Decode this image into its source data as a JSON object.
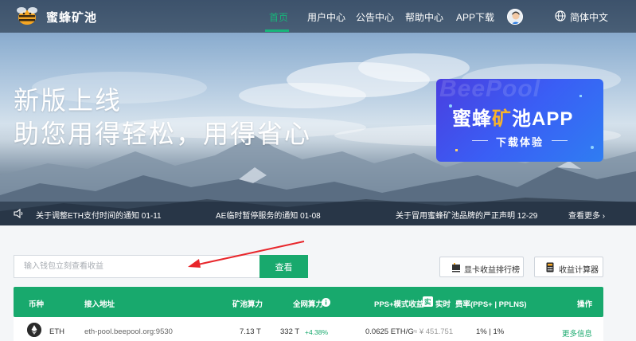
{
  "app": {
    "name": "蜜蜂矿池"
  },
  "nav": {
    "items": [
      {
        "label": "首页",
        "active": true
      },
      {
        "label": "用户中心"
      },
      {
        "label": "公告中心"
      },
      {
        "label": "帮助中心"
      },
      {
        "label": "APP下载"
      }
    ],
    "language": "简体中文"
  },
  "hero": {
    "line1": "新版上线",
    "line2": "助您用得轻松，用得省心"
  },
  "app_banner": {
    "bg_text": "BeePool",
    "title_part1": "蜜蜂",
    "title_part2": "矿",
    "title_part3": "池APP",
    "subtitle": "下载体验"
  },
  "notices": [
    "关于调整ETH支付时间的通知 01-11",
    "AE临时暂停服务的通知 01-08",
    "关于冒用蜜蜂矿池品牌的严正声明 12-29"
  ],
  "notice_more": "查看更多",
  "search": {
    "placeholder": "输入钱包立刻查看收益",
    "button": "查看"
  },
  "tools": {
    "gpu_rank": "显卡收益排行榜",
    "calculator": "收益计算器"
  },
  "table": {
    "headers": {
      "coin": "币种",
      "address": "接入地址",
      "pool_hashrate": "矿池算力",
      "network_hashrate": "全网算力",
      "pps_income": "PPS+模式收益",
      "realtime_badge": "实",
      "realtime": "实时",
      "fee": "费率(PPS+ | PPLNS)",
      "action": "操作"
    },
    "rows": [
      {
        "coin": "ETH",
        "address": "eth-pool.beepool.org:9530",
        "pool_hashrate": "7.13 T",
        "network_hashrate": "332 T",
        "network_change": "+4.38%",
        "income": "0.0625 ETH/G",
        "income_cny": "≈ ¥ 451.751",
        "fee": "1% | 1%",
        "action": "更多信息"
      }
    ]
  },
  "colors": {
    "accent": "#18a96d",
    "nav_active": "#18b57a",
    "banner": "#3a5ef5",
    "banner_highlight": "#f7b32b"
  }
}
